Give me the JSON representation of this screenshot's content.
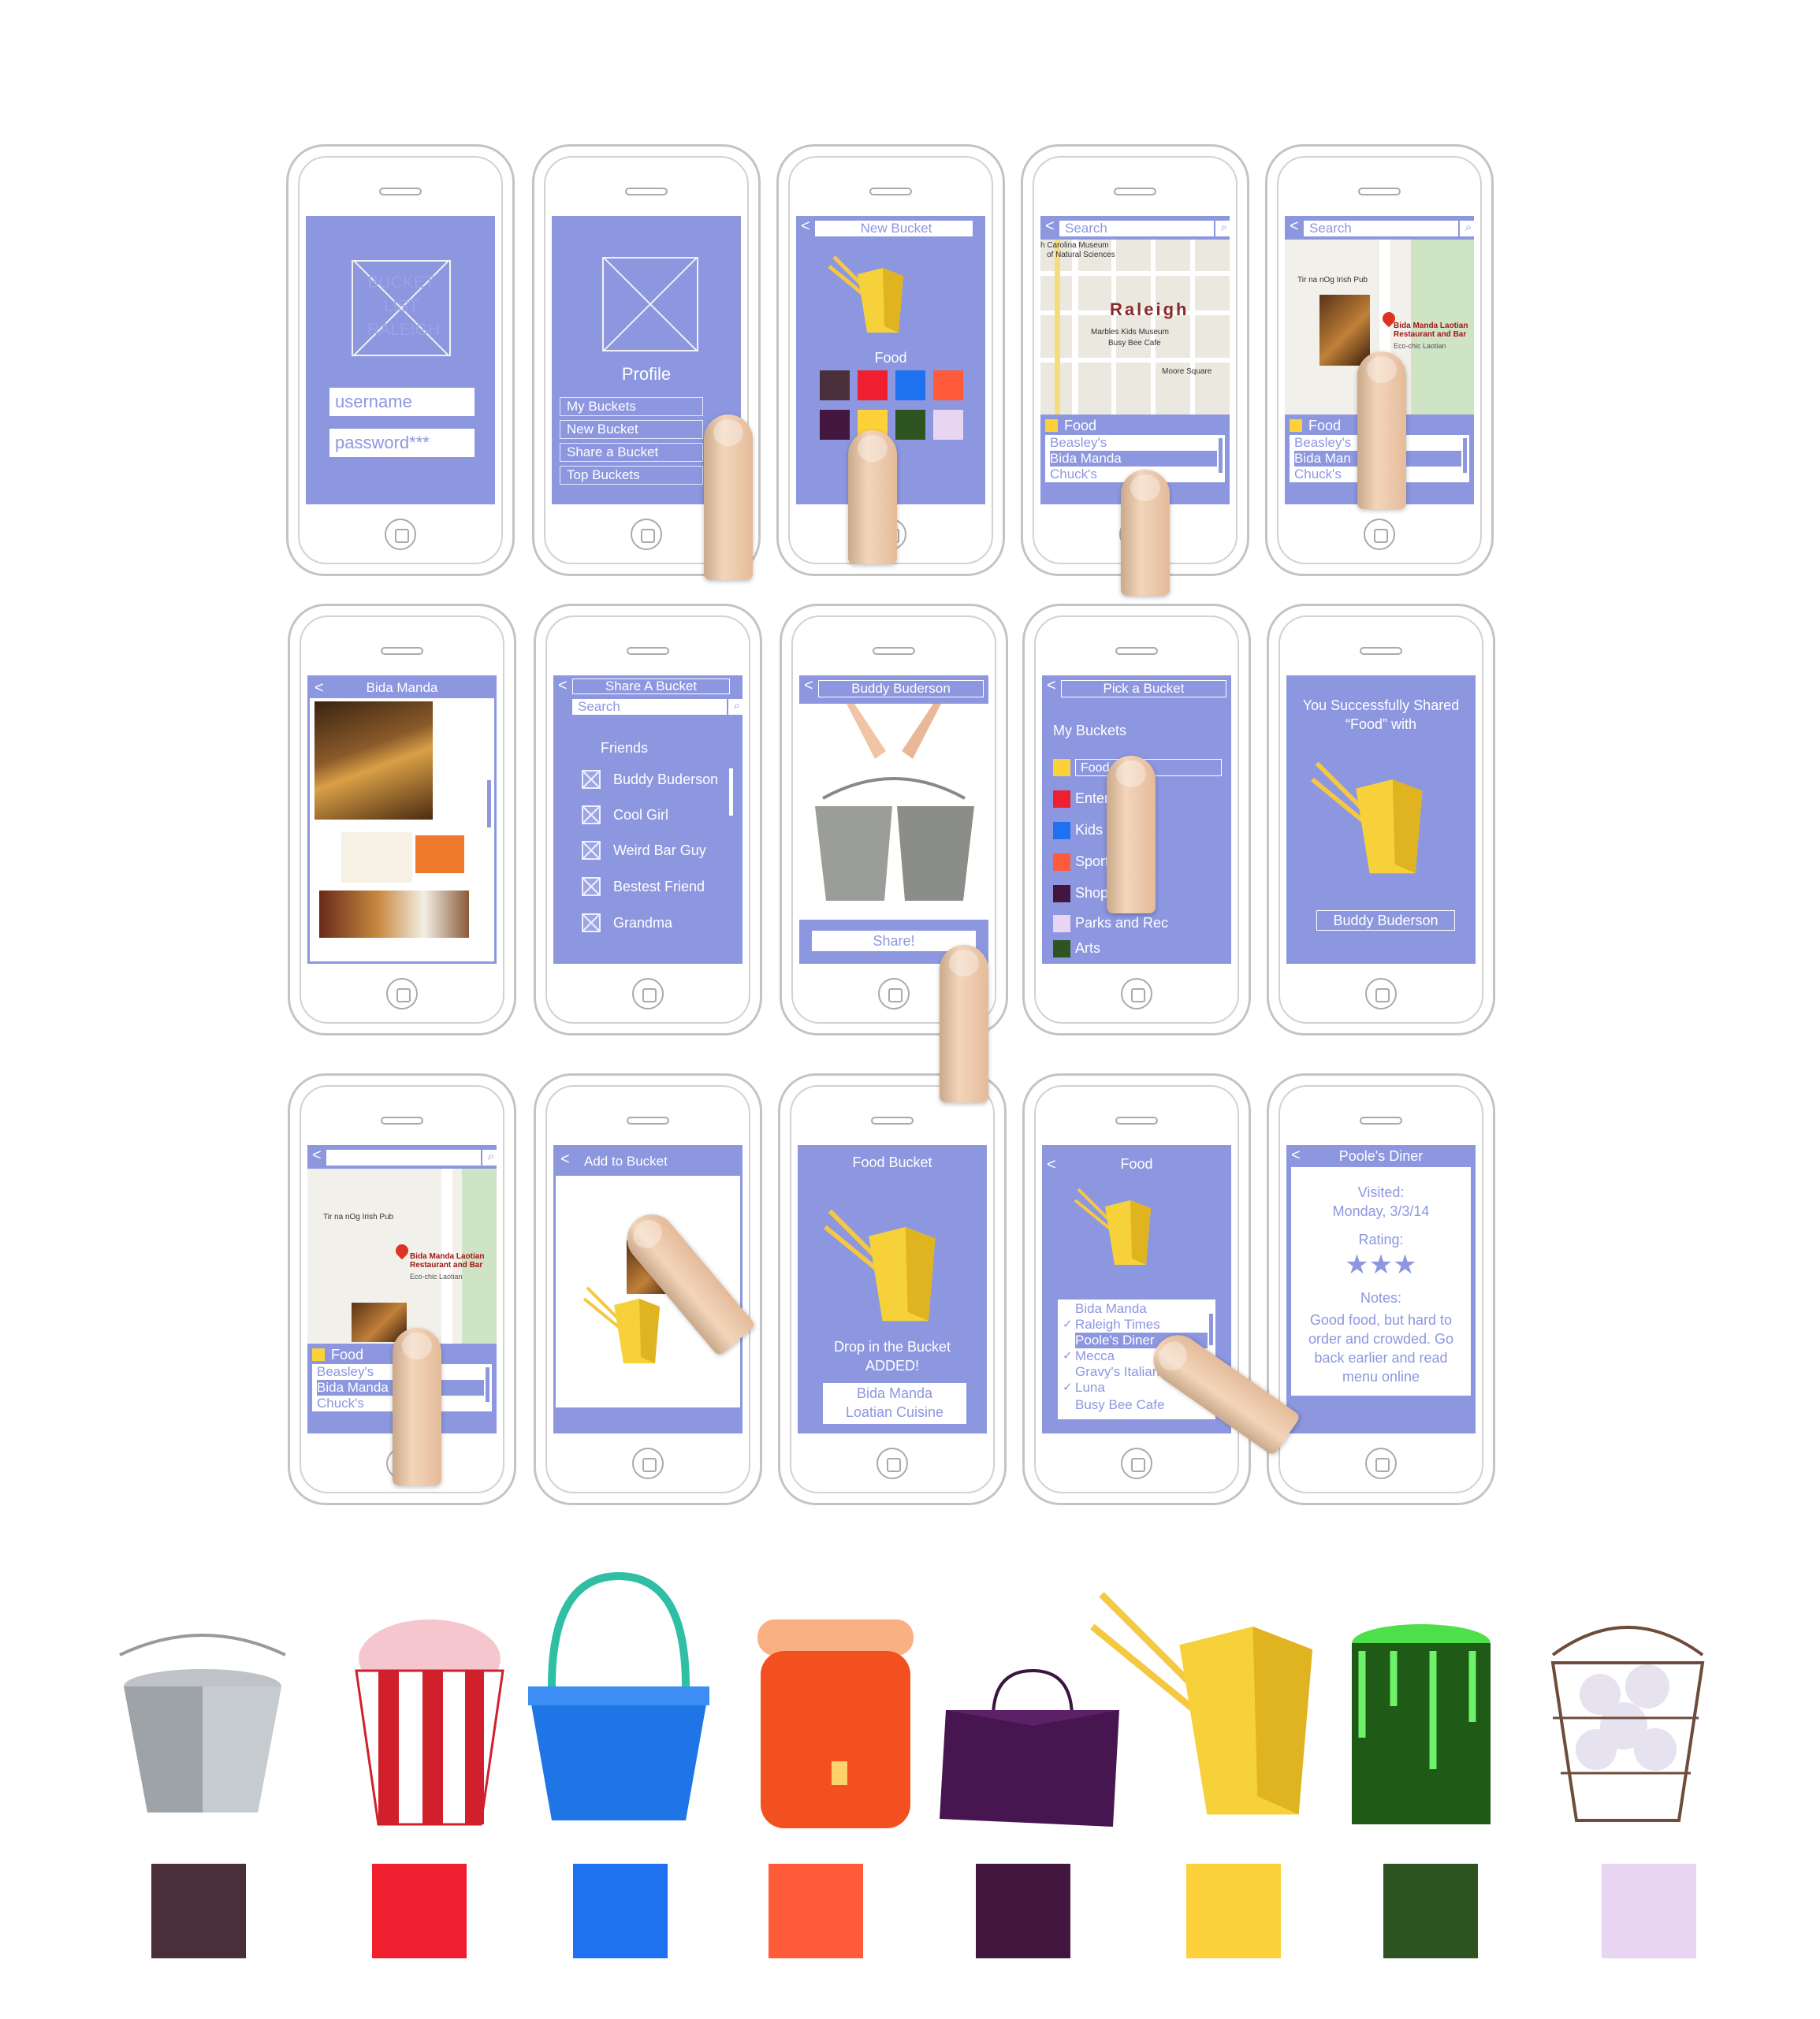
{
  "row1": {
    "login": {
      "logo": "BUCKET LIST RALEIGH",
      "username": "username",
      "password": "password***"
    },
    "profile": {
      "title": "Profile",
      "items": [
        "My Buckets",
        "New Bucket",
        "Share a Bucket",
        "Top Buckets"
      ]
    },
    "new_bucket": {
      "title": "New Bucket",
      "category": "Food"
    },
    "map1": {
      "search": "Search",
      "city": "Raleigh",
      "poi": [
        "h Carolina Museum",
        "of Natural Sciences",
        "Marbles Kids Museum",
        "Busy Bee Cafe",
        "Moore Square"
      ],
      "category": "Food",
      "list": [
        "Beasley's",
        "Bida Manda",
        "Chuck's"
      ]
    },
    "map2": {
      "search": "Search",
      "poi_pub": "Tir na nOg Irish Pub",
      "poi_main": "Bida Manda Laotian Restaurant and Bar",
      "poi_sub": "Eco-chic Laotian",
      "category": "Food",
      "list": [
        "Beasley's",
        "Bida Man",
        "Chuck's"
      ]
    }
  },
  "row2": {
    "detail": {
      "title": "Bida Manda"
    },
    "share": {
      "title": "Share A Bucket",
      "search": "Search",
      "section": "Friends",
      "friends": [
        "Buddy Buderson",
        "Cool Girl",
        "Weird Bar Guy",
        "Bestest Friend",
        "Grandma"
      ]
    },
    "buddy": {
      "title": "Buddy Buderson",
      "button": "Share!"
    },
    "pick": {
      "title": "Pick a Bucket",
      "section": "My Buckets",
      "buckets": [
        "Food",
        "Entertainment",
        "Kids Fun",
        "Sports",
        "Shopping",
        "Parks and Rec",
        "Arts"
      ],
      "visible": [
        "Food",
        "Enter",
        "Kids Fu",
        "Sports",
        "Shoppin",
        "Parks and Rec",
        "Arts"
      ]
    },
    "success": {
      "line1": "You Successfully Shared",
      "line2": "“Food” with",
      "friend": "Buddy Buderson"
    }
  },
  "row3": {
    "map3": {
      "poi_pub": "Tir na nOg Irish Pub",
      "poi_main": "Bida Manda Laotian Restaurant and Bar",
      "poi_sub": "Eco-chic Laotian",
      "category": "Food",
      "list": [
        "Beasley's",
        "Bida Manda",
        "Chuck's"
      ]
    },
    "add": {
      "title": "Add to Bucket"
    },
    "food_bucket": {
      "title": "Food Bucket",
      "line1": "Drop in the Bucket",
      "line2": "ADDED!",
      "item1": "Bida Manda",
      "item2": "Loatian Cuisine"
    },
    "food_list": {
      "title": "Food",
      "items": [
        "Bida Manda",
        "Raleigh Times",
        "Poole's Diner",
        "Mecca",
        "Gravy's Italian An",
        "Luna",
        "Busy Bee Cafe"
      ],
      "checked": [
        false,
        true,
        true,
        true,
        false,
        true,
        false
      ]
    },
    "diner": {
      "title": "Poole's Diner",
      "visited_label": "Visited:",
      "date": "Monday, 3/3/14",
      "rating_label": "Rating:",
      "stars": 3,
      "notes_label": "Notes:",
      "notes": [
        "Good food, but hard to",
        "order and crowded. Go",
        "back earlier and read",
        "menu online"
      ]
    }
  },
  "palette": [
    "#4a2f3b",
    "#ef1f2f",
    "#1e72f0",
    "#ff5a3a",
    "#42163f",
    "#fdd13a",
    "#2e5521",
    "#e8d5f2"
  ],
  "bucket_icons": [
    "metal-bucket-icon",
    "popcorn-icon",
    "sand-pail-icon",
    "water-cooler-icon",
    "shopping-bag-icon",
    "takeout-box-icon",
    "paint-can-icon",
    "wire-basket-icon"
  ]
}
